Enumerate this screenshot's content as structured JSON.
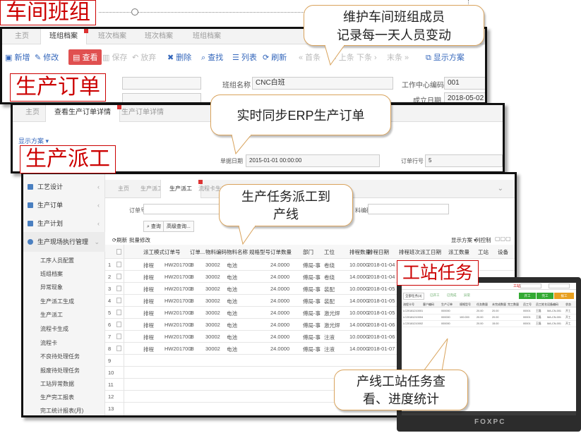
{
  "tags": {
    "team": "车间班组",
    "order": "生产订单",
    "dispatch": "生产派工",
    "station": "工站任务"
  },
  "bubbles": {
    "team_line1": "维护车间班组成员",
    "team_line2": "记录每一天人员变动",
    "order": "实时同步ERP生产订单",
    "dispatch_line1": "生产任务派工到",
    "dispatch_line2": "产线",
    "station_line1": "产线工站任务查",
    "station_line2": "看、进度统计"
  },
  "team_window": {
    "tabs": [
      "主页",
      "班组档案",
      "班次档案",
      "班次档案",
      "班组档案"
    ],
    "toolbar": {
      "new": "新增",
      "edit": "修改",
      "view": "查看",
      "save": "保存",
      "discard": "放弃",
      "delete": "删除",
      "find": "查找",
      "list": "列表",
      "refresh": "刷新",
      "first": "« 首条",
      "prev": "‹ 上条",
      "next": "下条 ›",
      "last": "末条 »",
      "display_scheme": "显示方案"
    },
    "fields": {
      "team_name_label": "班组名称",
      "team_name": "CNC白班",
      "work_center_label": "工作中心编码",
      "work_center": "001",
      "founded_label": "成立日期",
      "founded": "2018-05-02"
    }
  },
  "order_window": {
    "tabs": [
      "主页",
      "查看生产订单详情",
      "生产订单详情"
    ],
    "display_scheme": "显示方案 ▾",
    "fields": {
      "date_label": "单据日期",
      "date": "2015-01-01 00:00:00",
      "line_label": "订单行号",
      "line": "5"
    }
  },
  "dispatch_window": {
    "sidebar": {
      "items": [
        "工艺设计",
        "生产订单",
        "生产计划",
        "生产现场执行管理"
      ],
      "subitems": [
        "工序人员配置",
        "班组档案",
        "异常现象",
        "生产派工生成",
        "生产派工",
        "流程卡生成",
        "流程卡",
        "不良待处理任务",
        "报废待处理任务",
        "工站异常数据",
        "生产完工报表",
        "完工统计报表(月)"
      ]
    },
    "tabs": [
      "主页",
      "生产派工",
      "生产派工",
      "流程卡生成"
    ],
    "filter": {
      "order_no_label": "订单号",
      "material_label": "料编码",
      "query": "查询",
      "advanced": "高级查询..."
    },
    "actions": {
      "refresh": "刷新",
      "batch_edit": "批量修改",
      "display_scheme": "显示方案 ▾",
      "column_settings": "列控制"
    },
    "columns": [
      "",
      "派工模式",
      "订单号",
      "订单...",
      "物料编码",
      "物料名称",
      "规格型号",
      "订单数量",
      "部门",
      "工位",
      "排程数量",
      "排程日期",
      "排程班次",
      "派工日期",
      "派工数量",
      "工站",
      "设备"
    ],
    "rows": [
      [
        "1",
        "排程",
        "HW2017008",
        "1",
        "30002",
        "电池",
        "",
        "24.0000",
        "傅局-事",
        "卷绕",
        "10.0000",
        "2018-01-04",
        "白班"
      ],
      [
        "2",
        "排程",
        "HW2017008",
        "1",
        "30002",
        "电池",
        "",
        "24.0000",
        "傅局-事",
        "卷绕",
        "14.0000",
        "2018-01-04",
        "白班"
      ],
      [
        "3",
        "排程",
        "HW2017008",
        "1",
        "30002",
        "电池",
        "",
        "24.0000",
        "傅局-事",
        "装配",
        "10.0000",
        "2018-01-05",
        "白班"
      ],
      [
        "4",
        "排程",
        "HW2017008",
        "1",
        "30002",
        "电池",
        "",
        "24.0000",
        "傅局-事",
        "装配",
        "14.0000",
        "2018-01-05",
        "白班"
      ],
      [
        "5",
        "排程",
        "HW2017008",
        "1",
        "30002",
        "电池",
        "",
        "24.0000",
        "傅局-事",
        "激光焊",
        "10.0000",
        "2018-01-05",
        "白班"
      ],
      [
        "6",
        "排程",
        "HW2017008",
        "1",
        "30002",
        "电池",
        "",
        "24.0000",
        "傅局-事",
        "激光焊",
        "14.0000",
        "2018-01-06",
        "白班"
      ],
      [
        "7",
        "排程",
        "HW2017008",
        "1",
        "30002",
        "电池",
        "",
        "24.0000",
        "傅局-事",
        "注液",
        "10.0000",
        "2018-01-06",
        "白班"
      ],
      [
        "8",
        "排程",
        "HW2017008",
        "1",
        "30002",
        "电池",
        "",
        "24.0000",
        "傅局-事",
        "注液",
        "14.0000",
        "2018-01-07",
        "白班"
      ]
    ],
    "empty_rows": [
      "9",
      "10",
      "11",
      "12",
      "13",
      "14"
    ]
  },
  "tablet": {
    "brand": "FOXPC",
    "top_label": "工站",
    "tabs": [
      "全部任务(3)",
      "已开工",
      "已完成",
      "异常"
    ],
    "buttons": [
      "开工",
      "完工",
      "报工"
    ],
    "columns": [
      "流程卡号",
      "客户编码",
      "生产订单",
      "规格型号",
      "任务数量",
      "未完成数量",
      "完工数量",
      "员工号",
      "员工姓名",
      "设备编码",
      "状态"
    ],
    "rows": [
      [
        "LC20181210001",
        "",
        "000000",
        "",
        "20.00",
        "20.00",
        "",
        "00001",
        "王磊",
        "MA-CN-001",
        "开工"
      ],
      [
        "LC20181210004",
        "",
        "000000",
        "100.000",
        "20.00",
        "20.00",
        "",
        "00001",
        "王磊",
        "MA-CN-001",
        "开工"
      ],
      [
        "LC20181210002",
        "",
        "000000",
        "",
        "20.00",
        "15.00",
        "",
        "00001",
        "王磊",
        "MA-CN-001",
        "开工"
      ]
    ]
  },
  "colors": {
    "accent_red": "#cc0000",
    "bubble_border": "#d9a35c",
    "link_blue": "#3366bb",
    "view_button": "#e05050"
  }
}
